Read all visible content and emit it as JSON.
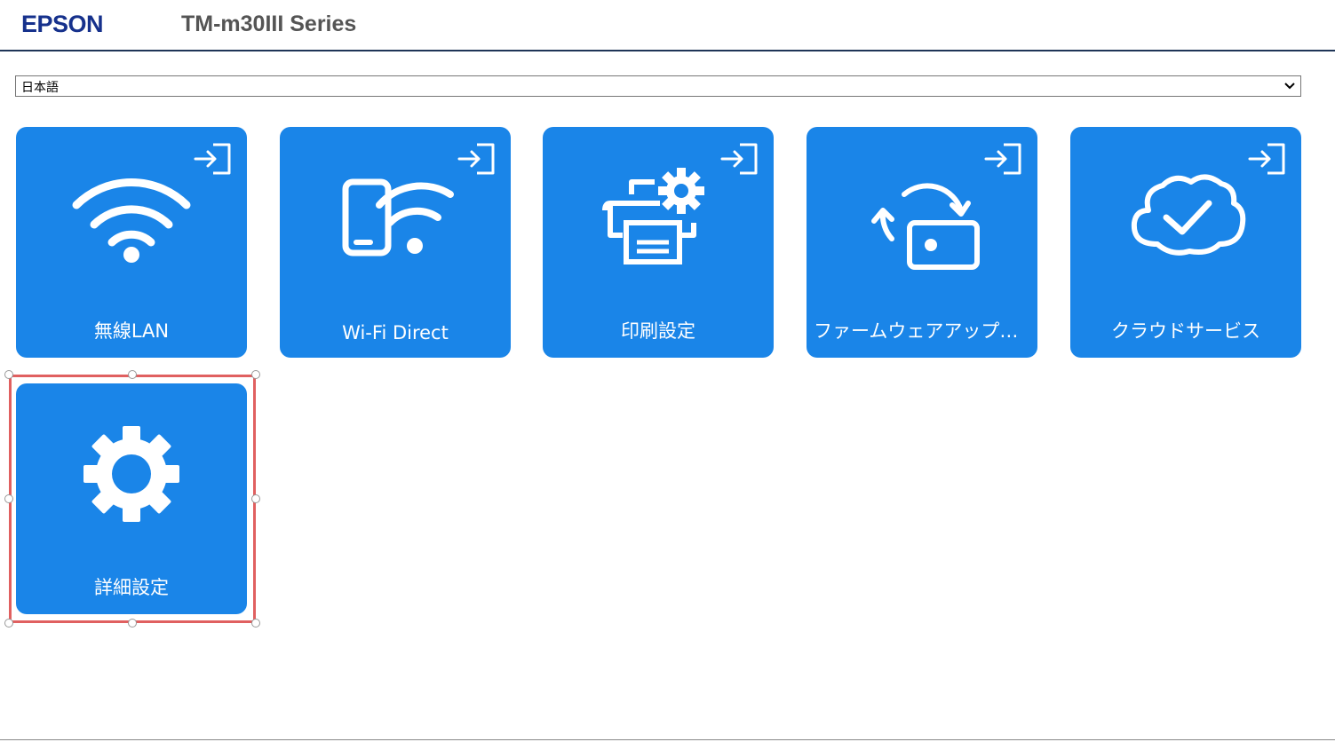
{
  "header": {
    "brand": "EPSON",
    "model": "TM-m30III Series"
  },
  "language_select": {
    "selected": "日本語"
  },
  "tiles": [
    {
      "label": "無線LAN",
      "icon": "wifi-icon"
    },
    {
      "label": "Wi-Fi Direct",
      "icon": "phone-wifi-icon"
    },
    {
      "label": "印刷設定",
      "icon": "printer-gear-icon"
    },
    {
      "label": "ファームウェアアップデート",
      "icon": "update-icon"
    },
    {
      "label": "クラウドサービス",
      "icon": "cloud-check-icon"
    },
    {
      "label": "詳細設定",
      "icon": "gear-icon"
    }
  ],
  "colors": {
    "tile": "#1a85e8",
    "brand": "#16318c",
    "selection": "#e06060"
  }
}
